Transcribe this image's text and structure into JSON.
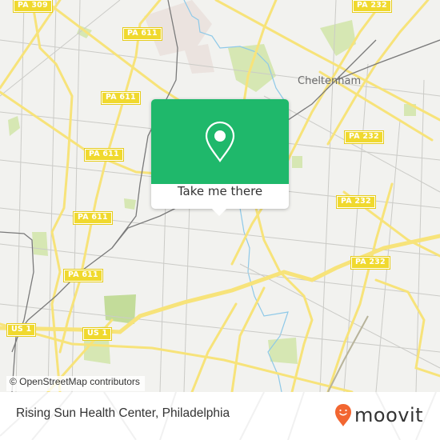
{
  "map": {
    "place_labels": [
      "Cheltenham"
    ],
    "route_shields": [
      {
        "id": "pa309-top",
        "text": "PA 309"
      },
      {
        "id": "pa611-1",
        "text": "PA 611"
      },
      {
        "id": "pa611-2",
        "text": "PA 611"
      },
      {
        "id": "pa611-3",
        "text": "PA 611"
      },
      {
        "id": "pa611-4",
        "text": "PA 611"
      },
      {
        "id": "pa611-5",
        "text": "PA 611"
      },
      {
        "id": "pa232-top",
        "text": "PA 232"
      },
      {
        "id": "pa232-2",
        "text": "PA 232"
      },
      {
        "id": "pa232-3",
        "text": "PA 232"
      },
      {
        "id": "pa232-4",
        "text": "PA 232"
      },
      {
        "id": "us1-left",
        "text": "US 1"
      },
      {
        "id": "us1-center",
        "text": "US 1"
      }
    ],
    "attribution": "© OpenStreetMap contributors",
    "colors": {
      "background": "#f2f2ef",
      "major_road": "#f7e37a",
      "minor_road": "#c8c8c4",
      "rail": "#777777",
      "water": "#8ec9e8",
      "park": "#cfe3a8",
      "shield": "#f0d92e"
    }
  },
  "popup": {
    "icon": "location-pin-icon",
    "button_label": "Take me there",
    "color": "#1fb86b"
  },
  "footer": {
    "location_title": "Rising Sun Health Center, Philadelphia",
    "brand": "moovit",
    "brand_color": "#f26631"
  }
}
